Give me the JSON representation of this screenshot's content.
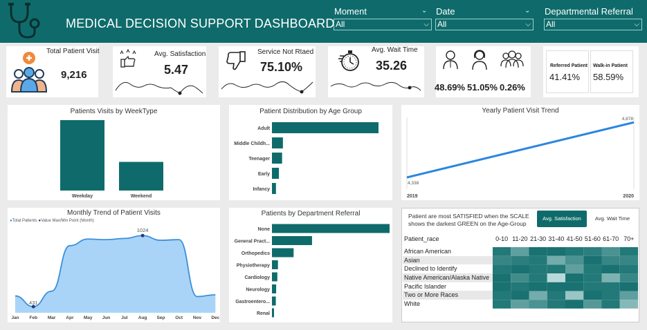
{
  "header": {
    "title": "MEDICAL DECISION SUPPORT DASHBOARD",
    "filters": [
      {
        "label": "Moment",
        "value": "All"
      },
      {
        "label": "Date",
        "value": "All"
      },
      {
        "label": "Departmental Referral",
        "value": "All"
      }
    ]
  },
  "kpis": {
    "total_visits": {
      "label": "Total Patient Visit",
      "value": "9,216"
    },
    "satisfaction": {
      "label": "Avg. Satisfaction",
      "value": "5.47"
    },
    "not_rated": {
      "label": "Service Not Rtaed",
      "value": "75.10%"
    },
    "wait_time": {
      "label": "Avg. Wait Time",
      "value": "35.26"
    },
    "gender": {
      "male": "48.69%",
      "female": "51.05%",
      "other": "0.26%"
    },
    "referral": {
      "referred_label": "Referred Patient",
      "referred_value": "41.41%",
      "walkin_label": "Walk-in Patient",
      "walkin_value": "58.59%"
    }
  },
  "week_chart": {
    "title": "Patients Visits by WeekType",
    "chart_data": {
      "type": "bar",
      "categories": [
        "Weekday",
        "Weekend"
      ],
      "values": [
        6550,
        2666
      ]
    }
  },
  "age_chart": {
    "title": "Patient Distribution by Age Group",
    "chart_data": {
      "type": "bar",
      "orientation": "horizontal",
      "categories": [
        "Adult",
        "Middle Childh...",
        "Teenager",
        "Early",
        "Infancy"
      ],
      "values": [
        5050,
        520,
        480,
        330,
        190
      ]
    }
  },
  "yearly_chart": {
    "title": "Yearly Patient Visit Trend",
    "chart_data": {
      "type": "line",
      "x": [
        "2019",
        "2020"
      ],
      "values": [
        4338,
        4878
      ],
      "point_labels": [
        "4,338",
        "4,878"
      ]
    }
  },
  "monthly_chart": {
    "title": "Monthly Trend of Patient Visits",
    "legend": [
      "Total Patients",
      "Value Max/Min Point (Month)"
    ],
    "chart_data": {
      "type": "area",
      "categories": [
        "Jan",
        "Feb",
        "Mar",
        "Apr",
        "May",
        "Jun",
        "Jul",
        "Aug",
        "Sep",
        "Oct",
        "Nov",
        "Dec"
      ],
      "values": [
        520,
        431,
        560,
        940,
        995,
        990,
        1000,
        1024,
        985,
        990,
        515,
        530
      ],
      "max_label": "1024",
      "min_label": "431"
    }
  },
  "dept_chart": {
    "title": "Patients by Department Referral",
    "chart_data": {
      "type": "bar",
      "orientation": "horizontal",
      "categories": [
        "None",
        "General Pract...",
        "Orthopedics",
        "Physiotherapy",
        "Cardiology",
        "Neurology",
        "Gastroentero...",
        "Renal"
      ],
      "values": [
        5400,
        1840,
        995,
        276,
        248,
        193,
        178,
        86
      ]
    }
  },
  "heatmap": {
    "note": "Patient are most SATISFIED when the SCALE shows the darkest GREEN on the Age-Group",
    "tab_active": "Avg. Satisfaction",
    "tab_inactive": "Avg. Wait Time",
    "row_header": "Patient_race",
    "chart_data": {
      "type": "heatmap",
      "columns": [
        "0-10",
        "11-20",
        "21-30",
        "31-40",
        "41-50",
        "51-60",
        "61-70",
        "70+"
      ],
      "rows": [
        "African American",
        "Asian",
        "Declined to Identify",
        "Native American/Alaska Native",
        "Pacific Islander",
        "Two or More Races",
        "White"
      ],
      "values": [
        [
          0.9,
          0.6,
          0.95,
          0.95,
          0.9,
          0.85,
          0.7,
          0.9
        ],
        [
          0.8,
          0.85,
          0.9,
          0.5,
          0.7,
          0.95,
          0.8,
          0.8
        ],
        [
          0.9,
          0.95,
          0.9,
          0.9,
          0.6,
          0.9,
          0.95,
          0.9
        ],
        [
          0.95,
          0.75,
          0.9,
          0.15,
          0.95,
          0.9,
          0.45,
          0.8
        ],
        [
          0.95,
          0.9,
          0.95,
          0.95,
          0.95,
          0.9,
          0.9,
          0.95
        ],
        [
          0.9,
          0.95,
          0.5,
          0.9,
          0.3,
          0.95,
          0.9,
          0.6
        ],
        [
          0.9,
          0.6,
          0.7,
          0.9,
          0.95,
          0.65,
          0.9,
          0.4
        ]
      ]
    }
  }
}
